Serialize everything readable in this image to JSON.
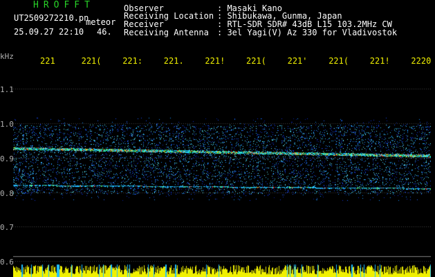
{
  "header": {
    "brand": "HROFFT",
    "filename": "UT2509272210.pn",
    "type": "meteor",
    "datetime": "25.09.27 22:10",
    "count": "46.",
    "info": [
      {
        "key": "Observer",
        "value": ": Masaki Kano"
      },
      {
        "key": "Receiving Location",
        "value": ": Shibukawa, Gunma, Japan"
      },
      {
        "key": "Receiver",
        "value": ": RTL-SDR SDR# 43dB L15 103.2MHz CW"
      },
      {
        "key": "Receiving Antenna",
        "value": ": 3el Yagi(V) Az 330 for Vladivostok"
      }
    ]
  },
  "axis": {
    "unit": "kHz",
    "x_labels": [
      "221",
      "221(",
      "221:",
      "221.",
      "221!",
      "221(",
      "221'",
      "221(",
      "221!",
      "2220"
    ],
    "y_labels": [
      "1.1",
      "1.0",
      "0.9",
      "0.8",
      "0.7",
      "0.6"
    ]
  },
  "colors": {
    "background": "#000000",
    "text": "#ffffff",
    "accent_yellow": "#f0f000",
    "brand_green": "#28d428",
    "noise_blue": "#1030d0",
    "signal_cyan": "#20d0ff",
    "signal_red": "#ff3020"
  }
}
